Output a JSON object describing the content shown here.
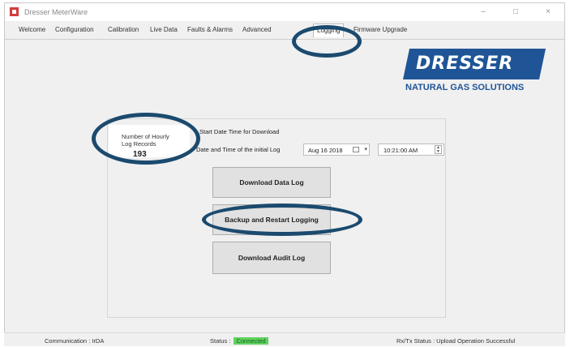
{
  "window": {
    "title": "Dresser MeterWare",
    "controls": {
      "minimize": "–",
      "maximize": "□",
      "close": "×"
    }
  },
  "tabs": [
    {
      "label": "Welcome"
    },
    {
      "label": "Configuration"
    },
    {
      "label": "Calibration"
    },
    {
      "label": "Live Data"
    },
    {
      "label": "Faults & Alarms"
    },
    {
      "label": "Advanced"
    },
    {
      "label": "Logging"
    },
    {
      "label": "Firmware Upgrade"
    }
  ],
  "active_tab": "Logging",
  "logo": {
    "name": "DRESSER",
    "subtitle": "NATURAL GAS SOLUTIONS",
    "color": "#1f5596"
  },
  "logging": {
    "hourly_records_label": "Number of Hourly Log Records",
    "hourly_records_value": "193",
    "start_label": "Start Date Time for Download",
    "initial_log_label": "Date and Time of the initial Log",
    "date_value": "Aug 16 2018",
    "time_value": "10:21:00 AM",
    "buttons": {
      "download_data": "Download Data Log",
      "backup_restart": "Backup and Restart Logging",
      "download_audit": "Download Audit Log"
    }
  },
  "statusbar": {
    "communication": "Communication : IrDA",
    "status_label": "Status :",
    "status_value": "Connected",
    "status_color": "#5fd35f",
    "rxtx": "Rx/Tx Status : Upload Operation Successful"
  },
  "highlight_color": "#1b4a6e"
}
